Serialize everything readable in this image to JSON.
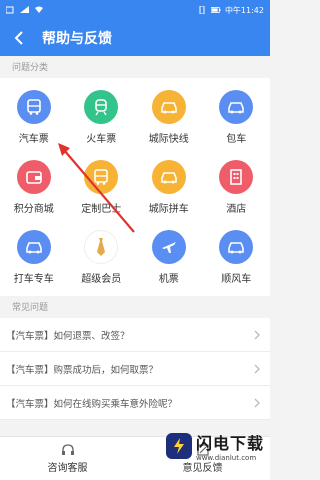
{
  "status_bar": {
    "carrier": "",
    "time": "中午11:42",
    "battery": ""
  },
  "header": {
    "title": "帮助与反馈"
  },
  "categories": {
    "label": "问题分类",
    "items": [
      {
        "label": "汽车票",
        "color": "#5b8ef2"
      },
      {
        "label": "火车票",
        "color": "#32c48a"
      },
      {
        "label": "城际快线",
        "color": "#f6b335"
      },
      {
        "label": "包车",
        "color": "#5b8ef2"
      },
      {
        "label": "积分商城",
        "color": "#ef5c6a"
      },
      {
        "label": "定制巴士",
        "color": "#f6b335"
      },
      {
        "label": "城际拼车",
        "color": "#f6b335"
      },
      {
        "label": "酒店",
        "color": "#ef5c6a"
      },
      {
        "label": "打车专车",
        "color": "#5b8ef2"
      },
      {
        "label": "超级会员",
        "color": "#ffffff"
      },
      {
        "label": "机票",
        "color": "#5b8ef2"
      },
      {
        "label": "顺风车",
        "color": "#5b8ef2"
      }
    ]
  },
  "faq": {
    "label": "常见问题",
    "items": [
      {
        "text": "【汽车票】如何退票、改签？"
      },
      {
        "text": "【汽车票】购票成功后，如何取票？"
      },
      {
        "text": "【汽车票】如何在线购买乘车意外险呢？"
      }
    ]
  },
  "bottom_bar": {
    "service": "咨询客服",
    "feedback": "意见反馈"
  },
  "watermark": {
    "title": "闪电下载",
    "url": "www.dianlut.com"
  }
}
